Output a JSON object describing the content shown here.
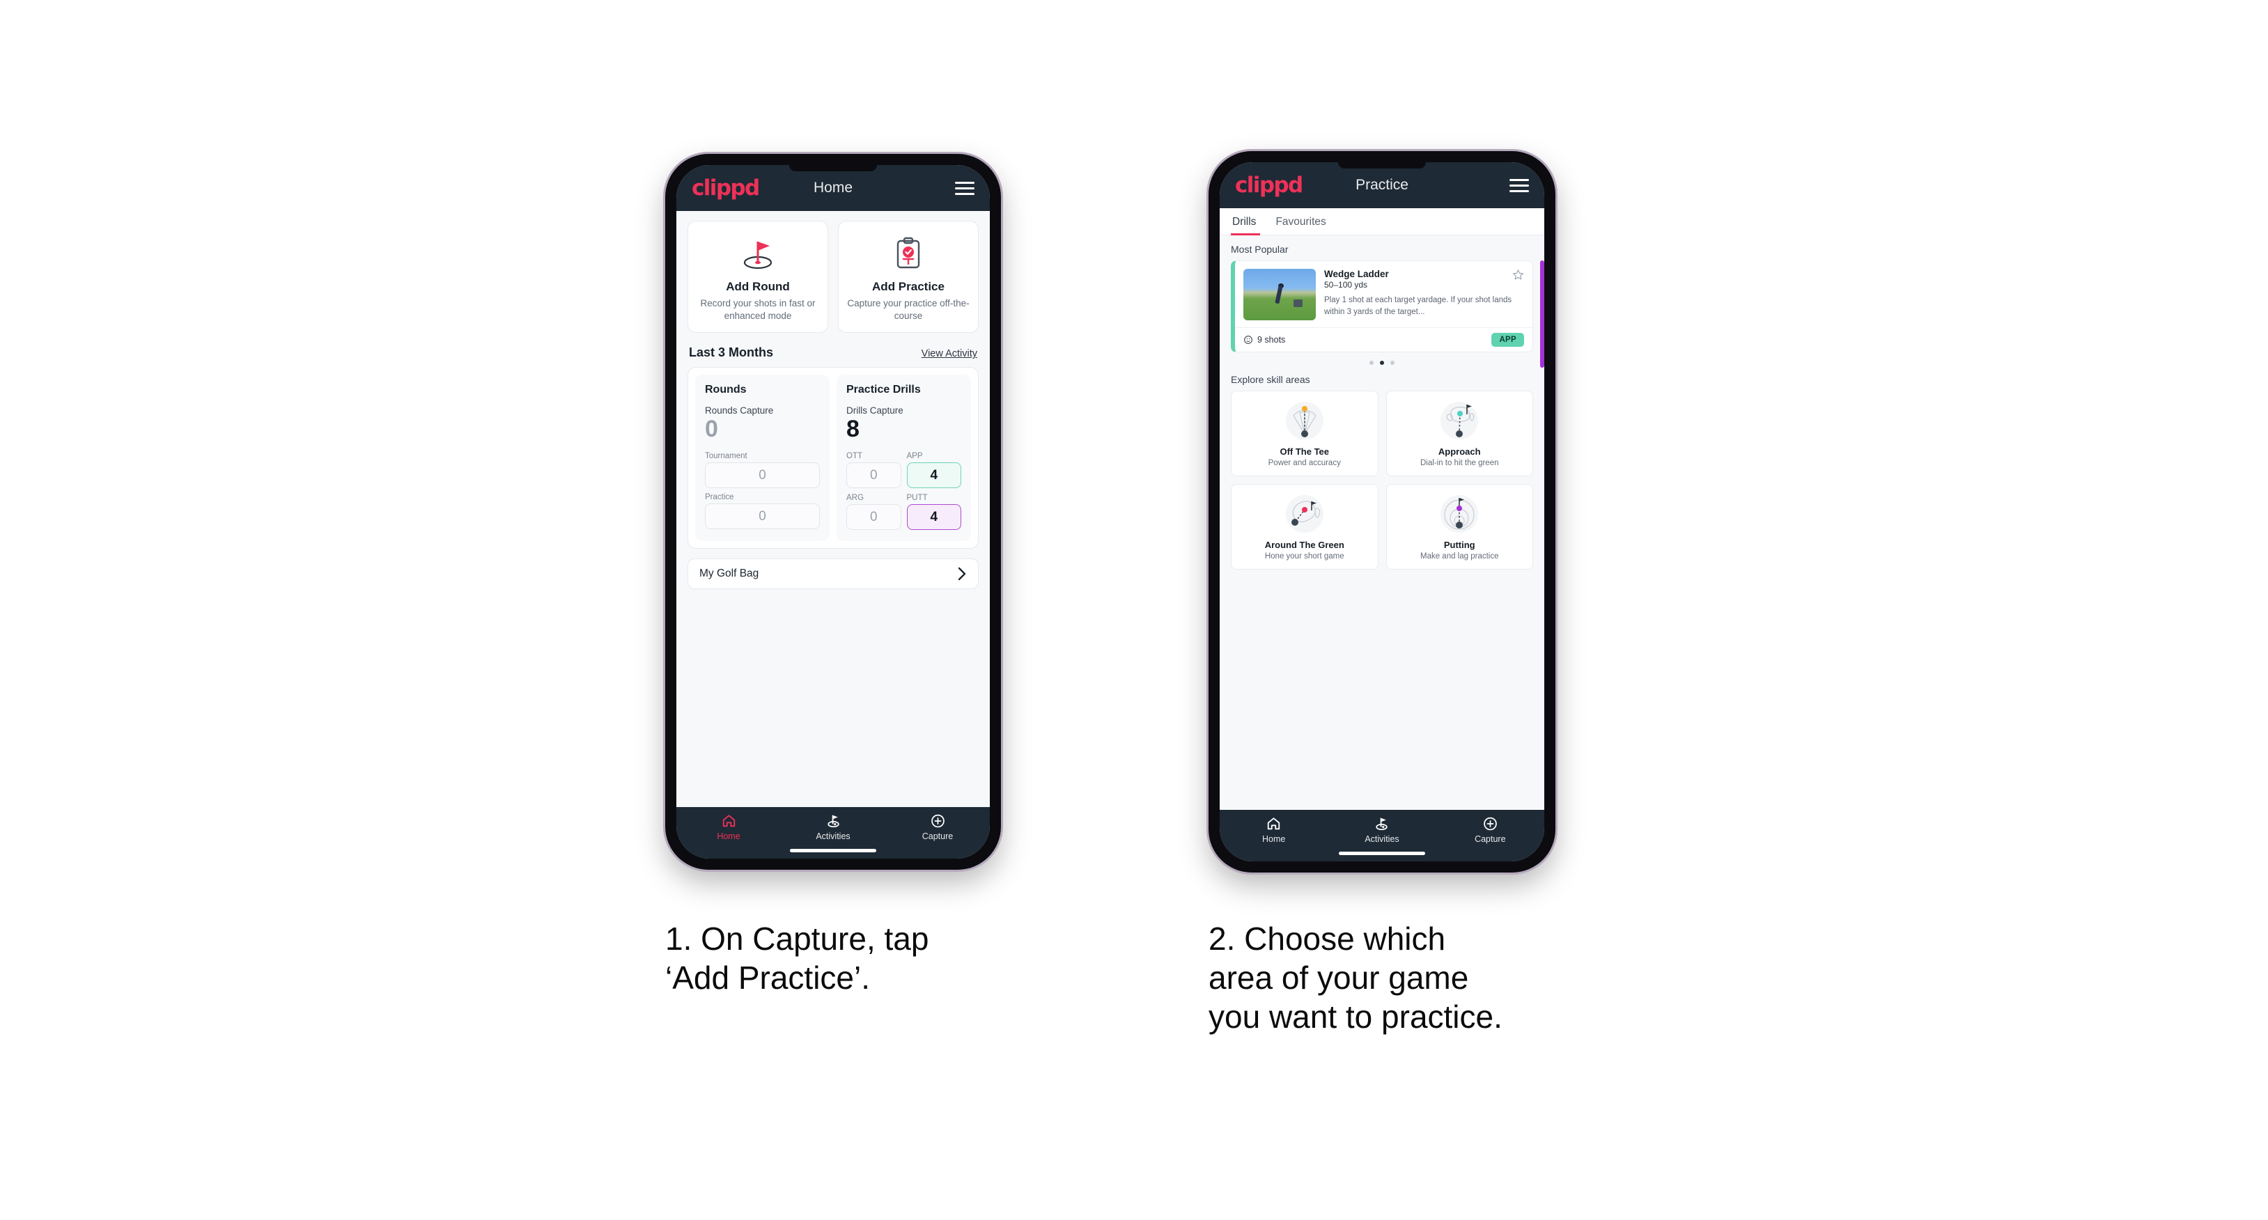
{
  "brand": {
    "name": "clippd",
    "accent": "#ee3158",
    "dark": "#1e2a35"
  },
  "phone1": {
    "header": {
      "title": "Home",
      "menu_icon": "hamburger-icon"
    },
    "quick_actions": [
      {
        "icon": "golf-flag-hole-icon",
        "title": "Add Round",
        "subtitle": "Record your shots in fast or enhanced mode"
      },
      {
        "icon": "clipboard-check-tee-icon",
        "title": "Add Practice",
        "subtitle": "Capture your practice off-the-course"
      }
    ],
    "section": {
      "title": "Last 3 Months",
      "link": "View Activity"
    },
    "rounds": {
      "heading": "Rounds",
      "capture_label": "Rounds Capture",
      "capture_value": "0",
      "rows": [
        {
          "label": "Tournament",
          "value": "0"
        },
        {
          "label": "Practice",
          "value": "0"
        }
      ]
    },
    "drills": {
      "heading": "Practice Drills",
      "capture_label": "Drills Capture",
      "capture_value": "8",
      "cells": [
        {
          "label": "OTT",
          "value": "0",
          "state": "empty"
        },
        {
          "label": "APP",
          "value": "4",
          "state": "app"
        },
        {
          "label": "ARG",
          "value": "0",
          "state": "empty"
        },
        {
          "label": "PUTT",
          "value": "4",
          "state": "putt"
        }
      ]
    },
    "golf_bag": {
      "label": "My Golf Bag",
      "chevron": "chevron-right-icon"
    },
    "bottom_nav": [
      {
        "icon": "home-icon",
        "label": "Home",
        "active": true
      },
      {
        "icon": "golf-flag-icon",
        "label": "Activities",
        "active": false
      },
      {
        "icon": "plus-circle-icon",
        "label": "Capture",
        "active": false
      }
    ]
  },
  "phone2": {
    "header": {
      "title": "Practice",
      "menu_icon": "hamburger-icon"
    },
    "tabs": [
      {
        "label": "Drills",
        "active": true
      },
      {
        "label": "Favourites",
        "active": false
      }
    ],
    "most_popular_label": "Most Popular",
    "drill": {
      "name": "Wedge Ladder",
      "range": "50–100 yds",
      "description": "Play 1 shot at each target yardage. If your shot lands within 3 yards of the target...",
      "shots": "9 shots",
      "tag": "APP",
      "tag_color": "#5fd3af",
      "accent_color": "#5fd3af",
      "favourite_icon": "star-outline-icon",
      "shots_icon": "clock-icon",
      "thumbnail": "golfer-wedge-shot-photo"
    },
    "carousel_dots": [
      false,
      true,
      false
    ],
    "explore_label": "Explore skill areas",
    "skill_areas": [
      {
        "icon": "off-the-tee-fan-icon",
        "name": "Off The Tee",
        "subtitle": "Power and accuracy",
        "dot_color": "#f5ab28"
      },
      {
        "icon": "approach-green-icon",
        "name": "Approach",
        "subtitle": "Dial-in to hit the green",
        "dot_color": "#4fd1c5"
      },
      {
        "icon": "around-the-green-icon",
        "name": "Around The Green",
        "subtitle": "Hone your short game",
        "dot_color": "#ee3158"
      },
      {
        "icon": "putting-rings-icon",
        "name": "Putting",
        "subtitle": "Make and lag practice",
        "dot_color": "#a531d8"
      }
    ],
    "bottom_nav": [
      {
        "icon": "home-icon",
        "label": "Home",
        "active": false
      },
      {
        "icon": "golf-flag-icon",
        "label": "Activities",
        "active": false
      },
      {
        "icon": "plus-circle-icon",
        "label": "Capture",
        "active": false
      }
    ]
  },
  "captions": {
    "step1": "1. On Capture, tap\n‘Add Practice’.",
    "step2": "2. Choose which\narea of your game\nyou want to practice."
  }
}
